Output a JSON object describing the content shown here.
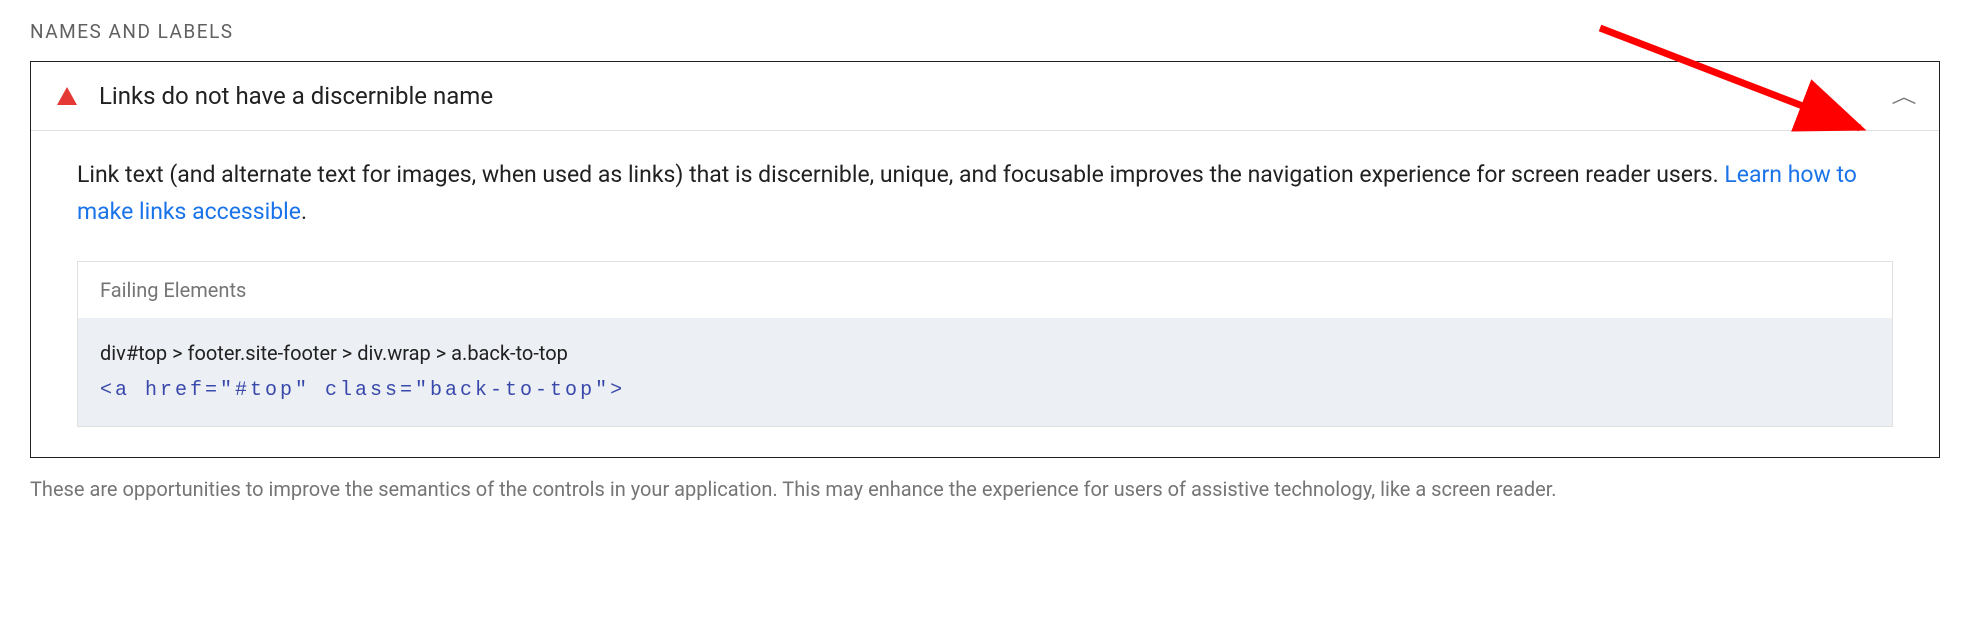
{
  "section": {
    "header": "NAMES AND LABELS"
  },
  "audit": {
    "title": "Links do not have a discernible name",
    "description_text": "Link text (and alternate text for images, when used as links) that is discernible, unique, and focusable improves the navigation experience for screen reader users. ",
    "learn_more_text": "Learn how to make links accessible",
    "period": "."
  },
  "failing": {
    "header": "Failing Elements",
    "selector": "div#top > footer.site-footer > div.wrap > a.back-to-top",
    "snippet": "<a href=\"#top\" class=\"back-to-top\">"
  },
  "footer": {
    "note": "These are opportunities to improve the semantics of the controls in your application. This may enhance the experience for users of assistive technology, like a screen reader."
  }
}
